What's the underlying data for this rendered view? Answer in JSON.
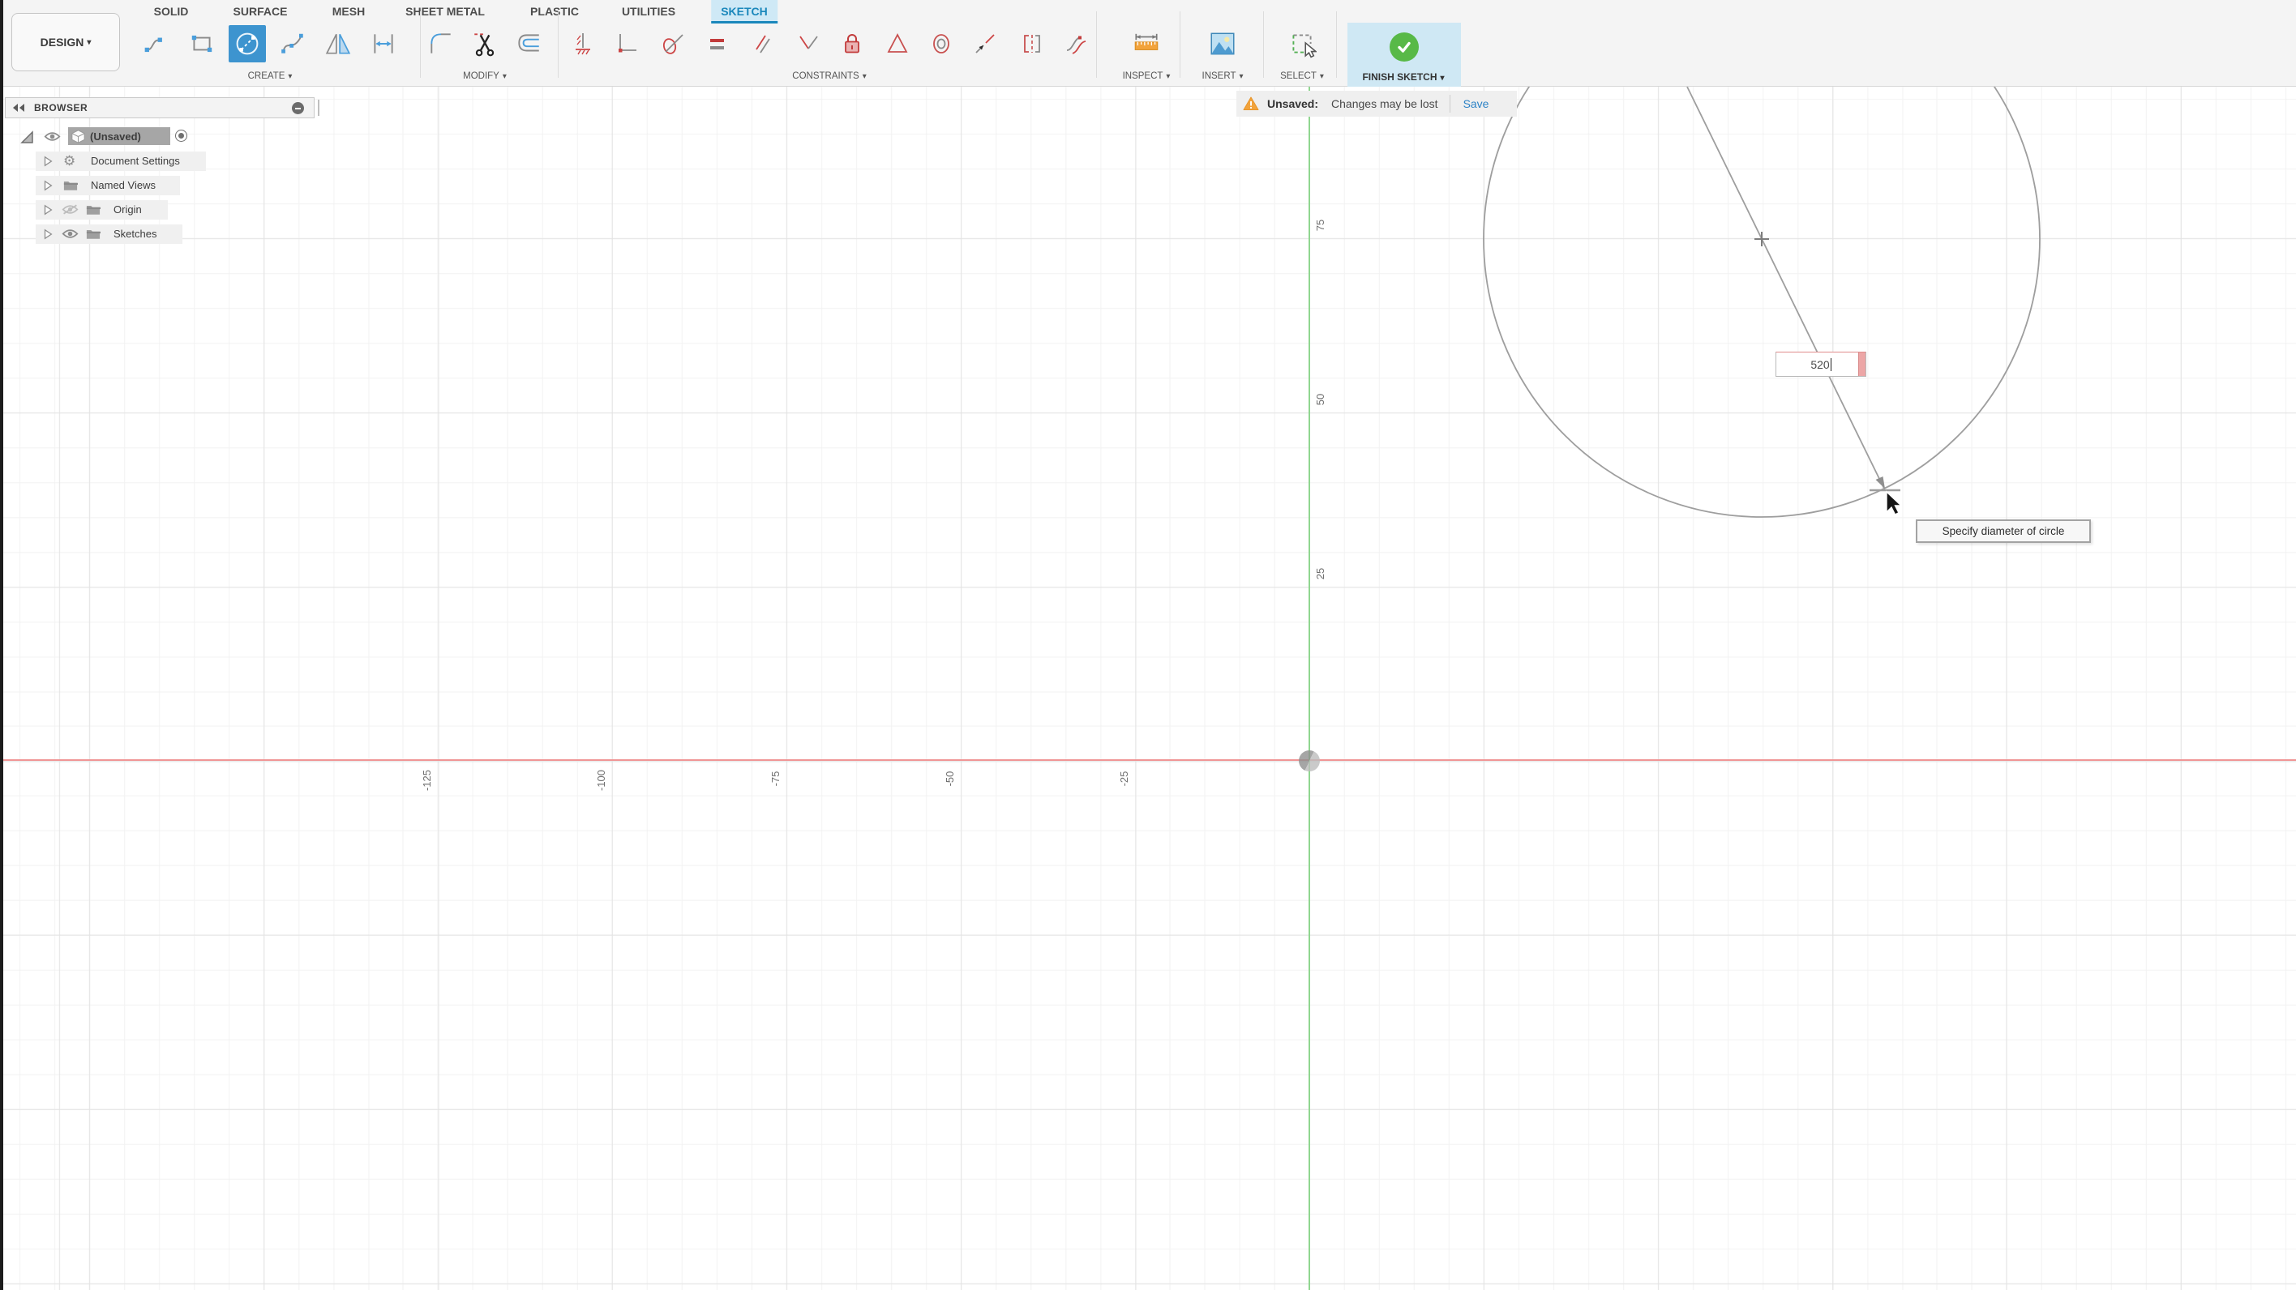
{
  "workspace": {
    "label": "DESIGN"
  },
  "tabs": [
    {
      "label": "SOLID"
    },
    {
      "label": "SURFACE"
    },
    {
      "label": "MESH"
    },
    {
      "label": "SHEET METAL"
    },
    {
      "label": "PLASTIC"
    },
    {
      "label": "UTILITIES"
    },
    {
      "label": "SKETCH",
      "active": true
    }
  ],
  "toolbar": {
    "groups": [
      {
        "label": "CREATE"
      },
      {
        "label": "MODIFY"
      },
      {
        "label": "CONSTRAINTS"
      },
      {
        "label": "INSPECT"
      },
      {
        "label": "INSERT"
      },
      {
        "label": "SELECT"
      },
      {
        "label": "FINISH SKETCH"
      }
    ]
  },
  "browser": {
    "title": "BROWSER",
    "root": {
      "label": "(Unsaved)"
    },
    "items": [
      {
        "label": "Document Settings"
      },
      {
        "label": "Named Views"
      },
      {
        "label": "Origin",
        "visible": false
      },
      {
        "label": "Sketches",
        "visible": true
      }
    ]
  },
  "notification": {
    "label": "Unsaved:",
    "message": "Changes may be lost",
    "action": "Save"
  },
  "canvas": {
    "x_axis_labels": [
      "-125",
      "-100",
      "-75",
      "-50",
      "-25"
    ],
    "y_axis_labels": [
      "75",
      "50",
      "25"
    ],
    "dimension_input": {
      "value": "520"
    },
    "tooltip": "Specify diameter of circle",
    "colors": {
      "x_axis": "#f09595",
      "y_axis": "#90d690",
      "sketch_geometry": "#9e9e9e",
      "active_tab": "#1a87bb",
      "finish_green": "#58b947",
      "selected_tool": "#3d94cf"
    }
  }
}
